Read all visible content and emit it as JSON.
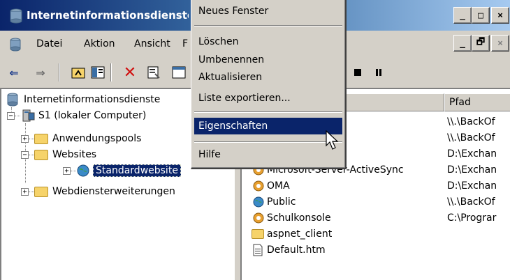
{
  "window": {
    "title": "Internetinformationsdienste",
    "sys_buttons": [
      "_",
      "□",
      "×"
    ],
    "mdi_buttons": [
      "_",
      "🗗",
      "×"
    ]
  },
  "menubar": {
    "items": [
      "Datei",
      "Aktion",
      "Ansicht",
      "F"
    ]
  },
  "toolbar": {
    "icons": [
      "back-arrow-icon",
      "forward-arrow-icon",
      "up-folder-icon",
      "show-hide-tree-icon",
      "delete-icon",
      "properties-icon",
      "console-icon",
      "stop-icon",
      "pause-icon"
    ]
  },
  "tree": {
    "root": "Internetinformationsdienste",
    "computer": "S1 (lokaler Computer)",
    "app_pools": "Anwendungspools",
    "websites": "Websites",
    "default_site": "Standardwebsite",
    "web_ext": "Webdiensterweiterungen"
  },
  "list": {
    "col_path": "Pfad",
    "rows": [
      {
        "name": "",
        "path": "\\\\.\\BackOf"
      },
      {
        "name": "",
        "path": "\\\\.\\BackOf"
      },
      {
        "name": "",
        "path": "D:\\Exchan"
      },
      {
        "name": "Microsoft-Server-ActiveSync",
        "path": "D:\\Exchan"
      },
      {
        "name": "OMA",
        "path": "D:\\Exchan"
      },
      {
        "name": "Public",
        "path": "\\\\.\\BackOf"
      },
      {
        "name": "Schulkonsole",
        "path": "C:\\Prograr"
      },
      {
        "name": "aspnet_client",
        "path": ""
      },
      {
        "name": "Default.htm",
        "path": ""
      }
    ]
  },
  "context_menu": {
    "new_window": "Neues Fenster",
    "delete": "Löschen",
    "rename": "Umbenennen",
    "refresh": "Aktualisieren",
    "export": "Liste exportieren...",
    "properties": "Eigenschaften",
    "help": "Hilfe"
  },
  "colors": {
    "titlebar_start": "#0a246a",
    "titlebar_end": "#a6caf0",
    "highlight": "#0a246a",
    "face": "#d4d0c8"
  }
}
